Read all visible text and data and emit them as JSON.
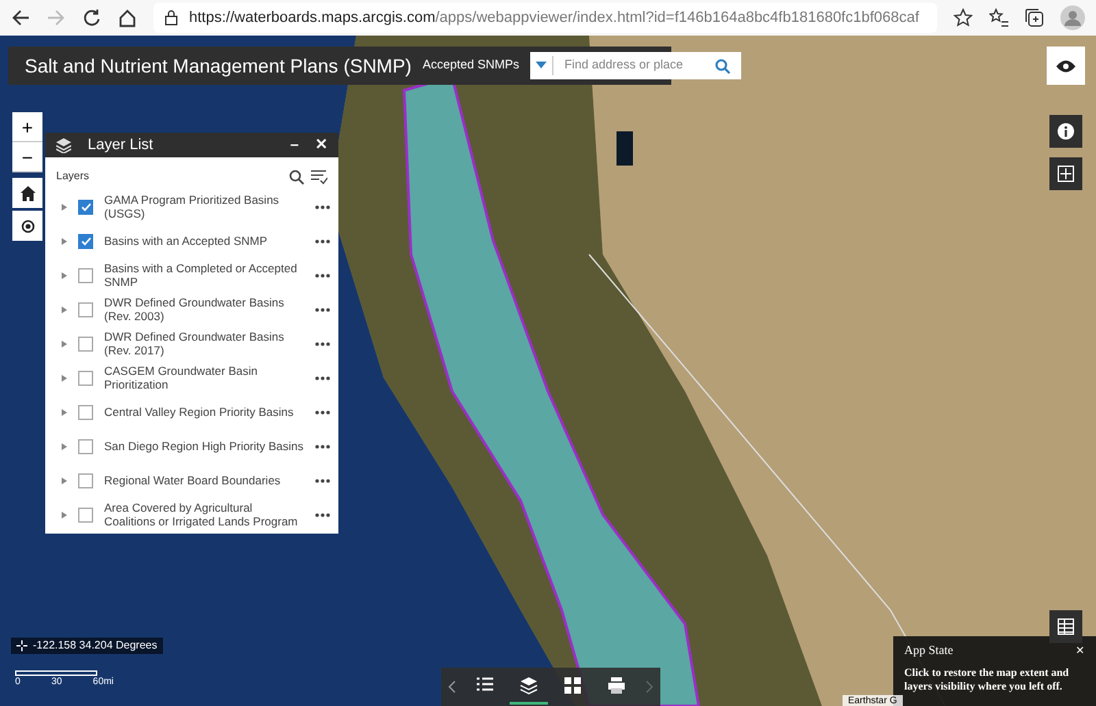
{
  "browser": {
    "url_host": "https://waterboards.maps.arcgis.com",
    "url_path": "/apps/webappviewer/index.html?id=f146b164a8bc4fb181680fc1bf068caf"
  },
  "header": {
    "title": "Salt and Nutrient Management Plans (SNMP)",
    "layer_label": "Accepted SNMPs",
    "search": {
      "placeholder": "Find address or place"
    }
  },
  "zoom_controls": [
    {
      "label": "+"
    },
    {
      "label": "−"
    }
  ],
  "layer_list": {
    "title": "Layer List",
    "section_label": "Layers",
    "minimize": "–",
    "close": "✕",
    "layers": [
      {
        "name": "GAMA Program Prioritized Basins (USGS)",
        "checked": true
      },
      {
        "name": "Basins with an Accepted SNMP",
        "checked": true
      },
      {
        "name": "Basins with a Completed or Accepted SNMP",
        "checked": false
      },
      {
        "name": "DWR Defined Groundwater Basins (Rev. 2003)",
        "checked": false
      },
      {
        "name": "DWR Defined Groundwater Basins (Rev. 2017)",
        "checked": false
      },
      {
        "name": "CASGEM Groundwater Basin Prioritization",
        "checked": false
      },
      {
        "name": "Central Valley Region Priority Basins",
        "checked": false
      },
      {
        "name": "San Diego Region High Priority Basins",
        "checked": false
      },
      {
        "name": "Regional Water Board Boundaries",
        "checked": false
      },
      {
        "name": "Area Covered by Agricultural Coalitions or Irrigated Lands Program",
        "checked": false
      }
    ]
  },
  "coordinates": "-122.158 34.204 Degrees",
  "scale_labels": [
    "0",
    "30",
    "60mi"
  ],
  "toolbar": [
    {
      "kind": "list",
      "selected": false
    },
    {
      "kind": "layers",
      "selected": true
    },
    {
      "kind": "grid",
      "selected": false
    },
    {
      "kind": "print",
      "selected": false
    }
  ],
  "app_state": {
    "title": "App State",
    "close": "✕",
    "message": "Click to restore the map extent and layers visibility where you left off."
  },
  "attribution": "Earthstar G"
}
